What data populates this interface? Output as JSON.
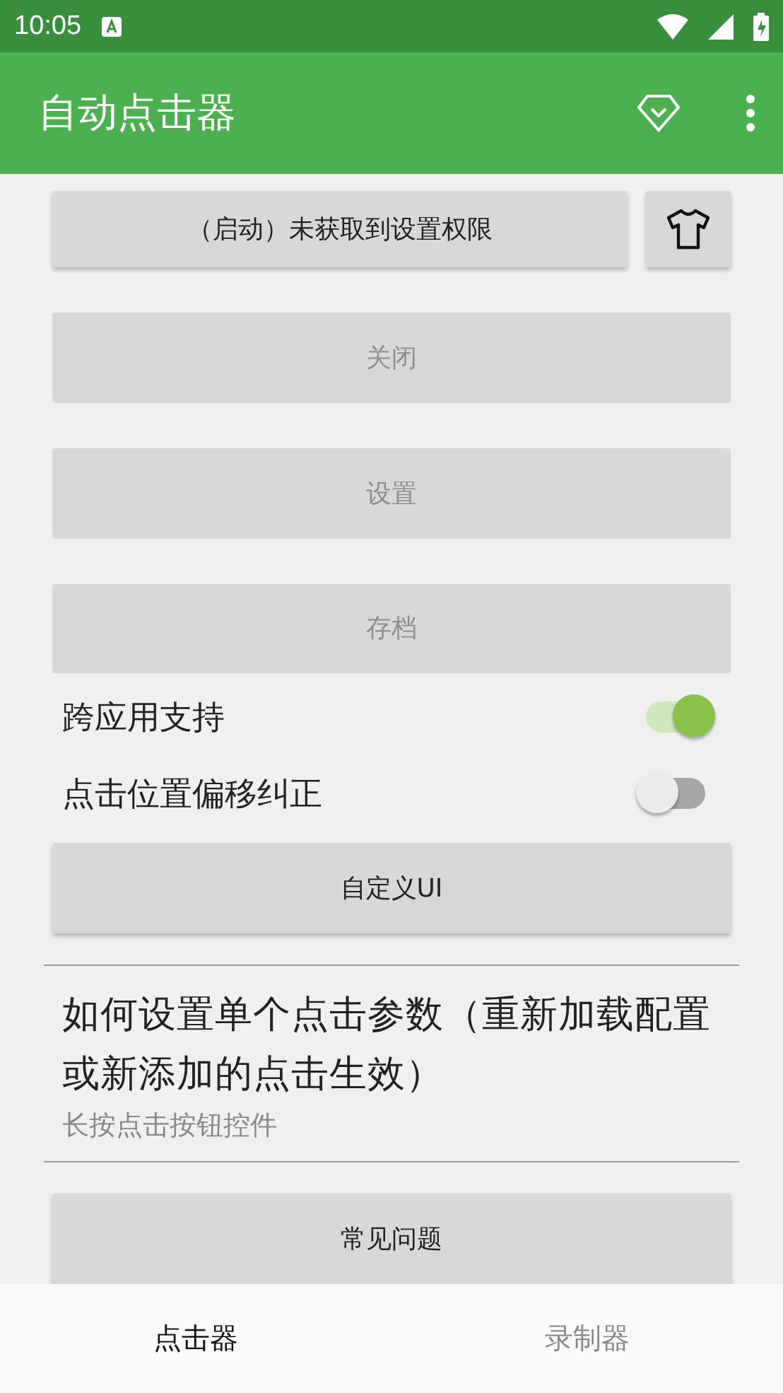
{
  "status_bar": {
    "time": "10:05"
  },
  "app_bar": {
    "title": "自动点击器"
  },
  "start_button": {
    "label": "（启动）未获取到设置权限",
    "disabled": false
  },
  "buttons": [
    {
      "label": "关闭",
      "disabled": true
    },
    {
      "label": "设置",
      "disabled": true
    },
    {
      "label": "存档",
      "disabled": true
    }
  ],
  "switches": [
    {
      "label": "跨应用支持",
      "on": true
    },
    {
      "label": "点击位置偏移纠正",
      "on": false
    }
  ],
  "custom_ui_button": {
    "label": "自定义UI",
    "disabled": false
  },
  "help": {
    "title": "如何设置单个点击参数（重新加载配置或新添加的点击生效）",
    "subtitle": "长按点击按钮控件"
  },
  "faq_button": {
    "label": "常见问题",
    "disabled": false
  },
  "bottom_nav": [
    {
      "label": "点击器",
      "selected": true
    },
    {
      "label": "录制器",
      "selected": false
    }
  ]
}
